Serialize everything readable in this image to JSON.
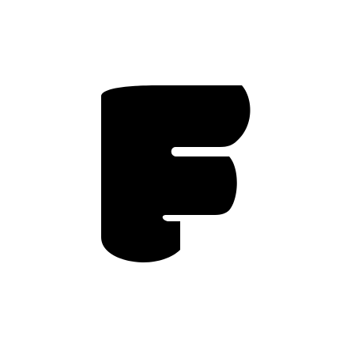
{
  "logo": {
    "icon": "letter-f-logo",
    "lettering": "F",
    "fill_color": "#000000",
    "background_color": "#ffffff"
  }
}
